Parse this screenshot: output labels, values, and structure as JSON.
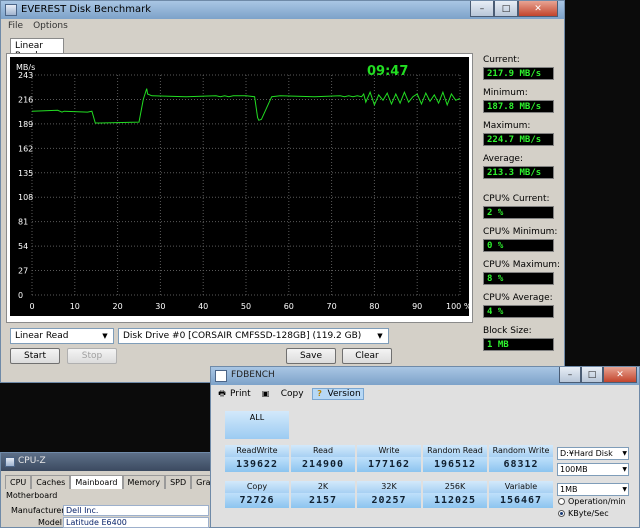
{
  "everest": {
    "title": "EVEREST Disk Benchmark",
    "menu": [
      "File",
      "Options"
    ],
    "window_buttons": [
      "–",
      "□",
      "✕"
    ],
    "tab": "Linear Read",
    "timer": "09:47",
    "test_select": "Linear Read",
    "drive_select": "Disk Drive #0  [CORSAIR CMFSSD-128GB]  (119.2 GB)",
    "buttons": {
      "start": "Start",
      "stop": "Stop",
      "save": "Save",
      "clear": "Clear"
    },
    "stats": [
      {
        "label": "Current:",
        "value": "217.9 MB/s"
      },
      {
        "label": "Minimum:",
        "value": "187.8 MB/s"
      },
      {
        "label": "Maximum:",
        "value": "224.7 MB/s"
      },
      {
        "label": "Average:",
        "value": "213.3 MB/s"
      },
      {
        "label": "CPU% Current:",
        "value": "2 %"
      },
      {
        "label": "CPU% Minimum:",
        "value": "0 %"
      },
      {
        "label": "CPU% Maximum:",
        "value": "8 %"
      },
      {
        "label": "CPU% Average:",
        "value": "4 %"
      },
      {
        "label": "Block Size:",
        "value": "1 MB"
      }
    ]
  },
  "chart_data": {
    "type": "line",
    "ylabel": "MB/s",
    "xlabel": "%",
    "ylim": [
      0,
      243
    ],
    "xlim": [
      0,
      100
    ],
    "yticks": [
      "243",
      "216",
      "189",
      "162",
      "135",
      "108",
      "81",
      "54",
      "27",
      "0"
    ],
    "xticks": [
      "0",
      "10",
      "20",
      "30",
      "40",
      "50",
      "60",
      "70",
      "80",
      "90",
      "100 %"
    ],
    "grid": true,
    "line_color": "#22dd22",
    "series": [
      {
        "x": [
          0,
          6,
          7,
          7.5,
          13,
          14,
          14.8,
          15.2,
          16,
          25,
          26,
          26.8,
          27,
          28,
          36,
          43,
          44,
          45,
          46,
          47,
          50,
          52,
          52.7,
          53,
          53.6,
          56,
          58,
          66,
          72,
          73,
          74,
          75,
          76,
          77,
          77.5,
          78,
          79,
          80,
          81,
          82,
          83,
          84,
          85,
          86,
          87,
          88,
          89,
          90,
          91,
          92,
          93,
          94,
          95,
          96,
          97,
          98,
          99,
          100
        ],
        "y": [
          203,
          204,
          202,
          203,
          202,
          203,
          190,
          190,
          190,
          191,
          216,
          228,
          222,
          220,
          219,
          220,
          219,
          220,
          219,
          220,
          220,
          219,
          196,
          193,
          194,
          219,
          220,
          219,
          220,
          219,
          220,
          219,
          220,
          219,
          222,
          213,
          224,
          210,
          221,
          215,
          223,
          211,
          222,
          212,
          224,
          213,
          219,
          222,
          211,
          223,
          214,
          221,
          212,
          224,
          210,
          222,
          215,
          217
        ]
      }
    ]
  },
  "cpuz": {
    "title": "CPU-Z",
    "tabs": [
      "CPU",
      "Caches",
      "Mainboard",
      "Memory",
      "SPD",
      "Graphics"
    ],
    "group": "Motherboard",
    "rows": [
      {
        "label": "Manufacturer",
        "value": "Dell Inc."
      },
      {
        "label": "Model",
        "value": "Latitude E6400"
      }
    ]
  },
  "fdbench": {
    "title": "FDBENCH",
    "toolbar": [
      "Print",
      "Copy",
      "Copy",
      "Version"
    ],
    "all_label": "ALL",
    "cells": [
      {
        "label": "ReadWrite",
        "value": "139622"
      },
      {
        "label": "Read",
        "value": "214900"
      },
      {
        "label": "Write",
        "value": "177162"
      },
      {
        "label": "Random Read",
        "value": "196512"
      },
      {
        "label": "Random Write",
        "value": "68312"
      },
      {
        "label": "Copy",
        "value": "72726"
      },
      {
        "label": "2K",
        "value": "2157"
      },
      {
        "label": "32K",
        "value": "20257"
      },
      {
        "label": "256K",
        "value": "112025"
      },
      {
        "label": "Variable",
        "value": "156467"
      }
    ],
    "drive_select": "D:¥Hard Disk",
    "size_select": "100MB",
    "block_select": "1MB",
    "radio_options": [
      "Operation/min",
      "KByte/Sec"
    ],
    "radio_selected": 1
  }
}
